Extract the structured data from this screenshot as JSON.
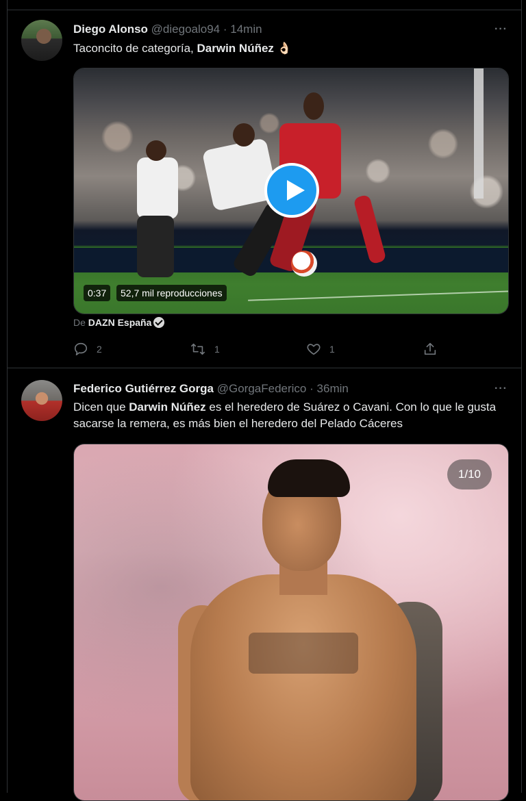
{
  "tweets": [
    {
      "author_name": "Diego Alonso",
      "handle": "@diegoalo94",
      "separator": "·",
      "time": "14min",
      "more": "···",
      "text_before": "Taconcito de categoría, ",
      "mention": "Darwin Núñez",
      "text_after": " 👌🏻",
      "media": {
        "type": "video",
        "duration": "0:37",
        "views": "52,7 mil reproducciones"
      },
      "source_prefix": "De",
      "source_name": "DAZN España",
      "actions": {
        "reply_count": "2",
        "retweet_count": "1",
        "like_count": "1"
      }
    },
    {
      "author_name": "Federico Gutiérrez Gorga",
      "handle": "@GorgaFederico",
      "separator": "·",
      "time": "36min",
      "more": "···",
      "text_before": "Dicen que ",
      "mention": "Darwin Núñez",
      "text_after": " es el heredero de Suárez o Cavani. Con lo que le gusta sacarse la remera, es más bien el heredero del Pelado Cáceres",
      "media": {
        "type": "photo",
        "counter": "1/10"
      }
    }
  ],
  "icons": {
    "reply": "reply-icon",
    "retweet": "retweet-icon",
    "like": "like-icon",
    "share": "share-icon",
    "play": "play-icon",
    "verified": "verified-badge-icon"
  },
  "colors": {
    "background": "#000000",
    "text": "#e7e9ea",
    "muted": "#71767b",
    "border": "#2f3336",
    "accent": "#1d9bf0"
  }
}
